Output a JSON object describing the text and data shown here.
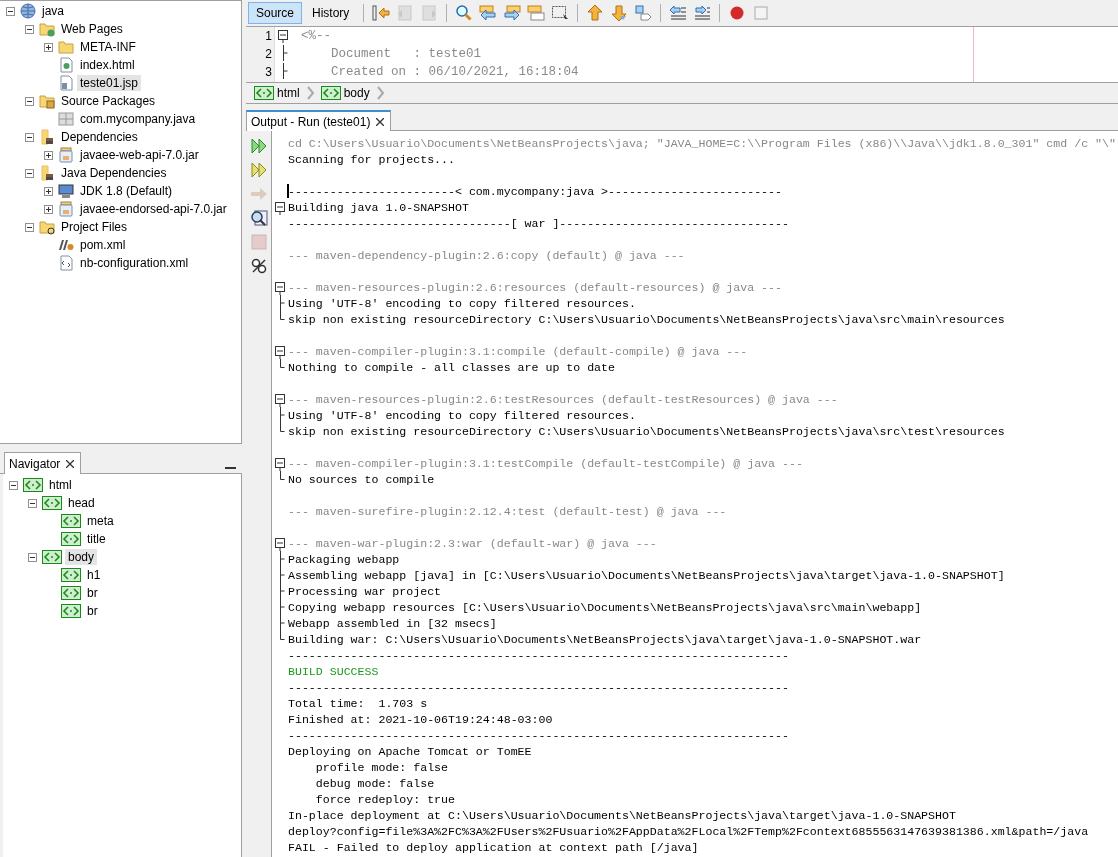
{
  "projects": {
    "tree": [
      {
        "label": "java",
        "kind": "project",
        "expanded": true,
        "selected": false,
        "children": [
          {
            "label": "Web Pages",
            "kind": "folder-web",
            "expanded": true,
            "selected": false,
            "children": [
              {
                "label": "META-INF",
                "kind": "folder",
                "expanded": false,
                "selected": false
              },
              {
                "label": "index.html",
                "kind": "html",
                "selected": false
              },
              {
                "label": "teste01.jsp",
                "kind": "jsp",
                "selected": true
              }
            ]
          },
          {
            "label": "Source Packages",
            "kind": "folder-pkg",
            "expanded": true,
            "selected": false,
            "children": [
              {
                "label": "com.mycompany.java",
                "kind": "package",
                "selected": false
              }
            ]
          },
          {
            "label": "Dependencies",
            "kind": "folder-lib",
            "expanded": true,
            "selected": false,
            "children": [
              {
                "label": "javaee-web-api-7.0.jar",
                "kind": "jar",
                "expanded": false,
                "selected": false
              }
            ]
          },
          {
            "label": "Java Dependencies",
            "kind": "folder-lib",
            "expanded": true,
            "selected": false,
            "children": [
              {
                "label": "JDK 1.8 (Default)",
                "kind": "jdk",
                "expanded": false,
                "selected": false
              },
              {
                "label": "javaee-endorsed-api-7.0.jar",
                "kind": "jar",
                "expanded": false,
                "selected": false
              }
            ]
          },
          {
            "label": "Project Files",
            "kind": "folder-files",
            "expanded": true,
            "selected": false,
            "children": [
              {
                "label": "pom.xml",
                "kind": "maven",
                "selected": false
              },
              {
                "label": "nb-configuration.xml",
                "kind": "xml",
                "selected": false
              }
            ]
          }
        ]
      }
    ]
  },
  "navigator": {
    "title": "Navigator",
    "tree": [
      {
        "label": "html",
        "kind": "tag",
        "expanded": true,
        "selected": false,
        "children": [
          {
            "label": "head",
            "kind": "tag",
            "expanded": true,
            "selected": false,
            "children": [
              {
                "label": "meta",
                "kind": "tag",
                "selected": false
              },
              {
                "label": "title",
                "kind": "tag",
                "selected": false
              }
            ]
          },
          {
            "label": "body",
            "kind": "tag",
            "expanded": true,
            "selected": true,
            "children": [
              {
                "label": "h1",
                "kind": "tag",
                "selected": false
              },
              {
                "label": "br",
                "kind": "tag",
                "selected": false
              },
              {
                "label": "br",
                "kind": "tag",
                "selected": false
              }
            ]
          }
        ]
      }
    ]
  },
  "editor": {
    "tabs": [
      {
        "label": "Source",
        "selected": true
      },
      {
        "label": "History",
        "selected": false
      }
    ],
    "toolbar": [
      {
        "kind": "last-edit"
      },
      {
        "kind": "back",
        "disabled": true
      },
      {
        "kind": "forward",
        "disabled": true
      },
      {
        "kind": "sep"
      },
      {
        "kind": "find"
      },
      {
        "kind": "find-prev"
      },
      {
        "kind": "find-next"
      },
      {
        "kind": "toggle-highlight"
      },
      {
        "kind": "rect-select"
      },
      {
        "kind": "sep"
      },
      {
        "kind": "prev-bookmark"
      },
      {
        "kind": "next-bookmark"
      },
      {
        "kind": "toggle-bookmark"
      },
      {
        "kind": "sep"
      },
      {
        "kind": "shift-left"
      },
      {
        "kind": "shift-right"
      },
      {
        "kind": "sep"
      },
      {
        "kind": "record"
      },
      {
        "kind": "stop"
      }
    ],
    "lines": [
      {
        "number": "1",
        "gutter": {
          "kind": "start"
        },
        "text": "<%--"
      },
      {
        "number": "2",
        "gutter": {
          "kind": "in"
        },
        "text": "    Document   : teste01"
      },
      {
        "number": "3",
        "gutter": {
          "kind": "in"
        },
        "text": "    Created on : 06/10/2021, 16:18:04"
      }
    ],
    "breadcrumbs": [
      "html",
      "body"
    ]
  },
  "output": {
    "title": "Output - Run (teste01)",
    "actions": [
      {
        "kind": "rerun",
        "disabled": false
      },
      {
        "kind": "rerun-options",
        "disabled": false
      },
      {
        "kind": "continue",
        "disabled": true
      },
      {
        "kind": "inspect",
        "disabled": false
      },
      {
        "kind": "stop",
        "disabled": true
      },
      {
        "kind": "settings",
        "disabled": false
      }
    ],
    "lines": [
      {
        "kind": "command",
        "text": "cd C:\\Users\\Usuario\\Documents\\NetBeansProjects\\java; \"JAVA_HOME=C:\\\\Program Files (x86)\\\\Java\\\\jdk1.8.0_301\" cmd /c \"\\\""
      },
      {
        "kind": "normal",
        "text": "Scanning for projects..."
      },
      {
        "kind": "blank"
      },
      {
        "kind": "normal",
        "gutter": {
          "kind": "caret"
        },
        "text": "------------------------< com.mycompany:java >-------------------------"
      },
      {
        "kind": "normal",
        "gutter": {
          "kind": "start"
        },
        "text": "Building java 1.0-SNAPSHOT"
      },
      {
        "kind": "normal",
        "text": "--------------------------------[ war ]---------------------------------"
      },
      {
        "kind": "blank"
      },
      {
        "kind": "plugin",
        "text": "--- maven-dependency-plugin:2.6:copy (default) @ java ---"
      },
      {
        "kind": "blank"
      },
      {
        "kind": "plugin",
        "gutter": {
          "kind": "start"
        },
        "text": "--- maven-resources-plugin:2.6:resources (default-resources) @ java ---"
      },
      {
        "kind": "normal",
        "gutter": {
          "kind": "in"
        },
        "text": "Using 'UTF-8' encoding to copy filtered resources."
      },
      {
        "kind": "normal",
        "gutter": {
          "kind": "end"
        },
        "text": "skip non existing resourceDirectory C:\\Users\\Usuario\\Documents\\NetBeansProjects\\java\\src\\main\\resources"
      },
      {
        "kind": "blank"
      },
      {
        "kind": "plugin",
        "gutter": {
          "kind": "start"
        },
        "text": "--- maven-compiler-plugin:3.1:compile (default-compile) @ java ---"
      },
      {
        "kind": "normal",
        "gutter": {
          "kind": "end"
        },
        "text": "Nothing to compile - all classes are up to date"
      },
      {
        "kind": "blank"
      },
      {
        "kind": "plugin",
        "gutter": {
          "kind": "start"
        },
        "text": "--- maven-resources-plugin:2.6:testResources (default-testResources) @ java ---"
      },
      {
        "kind": "normal",
        "gutter": {
          "kind": "in"
        },
        "text": "Using 'UTF-8' encoding to copy filtered resources."
      },
      {
        "kind": "normal",
        "gutter": {
          "kind": "end"
        },
        "text": "skip non existing resourceDirectory C:\\Users\\Usuario\\Documents\\NetBeansProjects\\java\\src\\test\\resources"
      },
      {
        "kind": "blank"
      },
      {
        "kind": "plugin",
        "gutter": {
          "kind": "start"
        },
        "text": "--- maven-compiler-plugin:3.1:testCompile (default-testCompile) @ java ---"
      },
      {
        "kind": "normal",
        "gutter": {
          "kind": "end"
        },
        "text": "No sources to compile"
      },
      {
        "kind": "blank"
      },
      {
        "kind": "plugin",
        "text": "--- maven-surefire-plugin:2.12.4:test (default-test) @ java ---"
      },
      {
        "kind": "blank"
      },
      {
        "kind": "plugin",
        "gutter": {
          "kind": "start"
        },
        "text": "--- maven-war-plugin:2.3:war (default-war) @ java ---"
      },
      {
        "kind": "normal",
        "gutter": {
          "kind": "in"
        },
        "text": "Packaging webapp"
      },
      {
        "kind": "normal",
        "gutter": {
          "kind": "in"
        },
        "text": "Assembling webapp [java] in [C:\\Users\\Usuario\\Documents\\NetBeansProjects\\java\\target\\java-1.0-SNAPSHOT]"
      },
      {
        "kind": "normal",
        "gutter": {
          "kind": "in"
        },
        "text": "Processing war project"
      },
      {
        "kind": "normal",
        "gutter": {
          "kind": "in"
        },
        "text": "Copying webapp resources [C:\\Users\\Usuario\\Documents\\NetBeansProjects\\java\\src\\main\\webapp]"
      },
      {
        "kind": "normal",
        "gutter": {
          "kind": "in"
        },
        "text": "Webapp assembled in [32 msecs]"
      },
      {
        "kind": "normal",
        "gutter": {
          "kind": "end"
        },
        "text": "Building war: C:\\Users\\Usuario\\Documents\\NetBeansProjects\\java\\target\\java-1.0-SNAPSHOT.war"
      },
      {
        "kind": "normal",
        "text": "------------------------------------------------------------------------"
      },
      {
        "kind": "success",
        "text": "BUILD SUCCESS"
      },
      {
        "kind": "normal",
        "text": "------------------------------------------------------------------------"
      },
      {
        "kind": "normal",
        "text": "Total time:  1.703 s"
      },
      {
        "kind": "normal",
        "text": "Finished at: 2021-10-06T19:24:48-03:00"
      },
      {
        "kind": "normal",
        "text": "------------------------------------------------------------------------"
      },
      {
        "kind": "normal",
        "text": "Deploying on Apache Tomcat or TomEE"
      },
      {
        "kind": "normal",
        "text": "    profile mode: false"
      },
      {
        "kind": "normal",
        "text": "    debug mode: false"
      },
      {
        "kind": "normal",
        "text": "    force redeploy: true"
      },
      {
        "kind": "normal",
        "text": "In-place deployment at C:\\Users\\Usuario\\Documents\\NetBeansProjects\\java\\target\\java-1.0-SNAPSHOT"
      },
      {
        "kind": "normal",
        "text": "deploy?config=file%3A%2FC%3A%2FUsers%2FUsuario%2FAppData%2FLocal%2FTemp%2Fcontext6855563147639381386.xml&path=/java"
      },
      {
        "kind": "normal",
        "text": "FAIL - Failed to deploy application at context path [/java]"
      }
    ]
  }
}
